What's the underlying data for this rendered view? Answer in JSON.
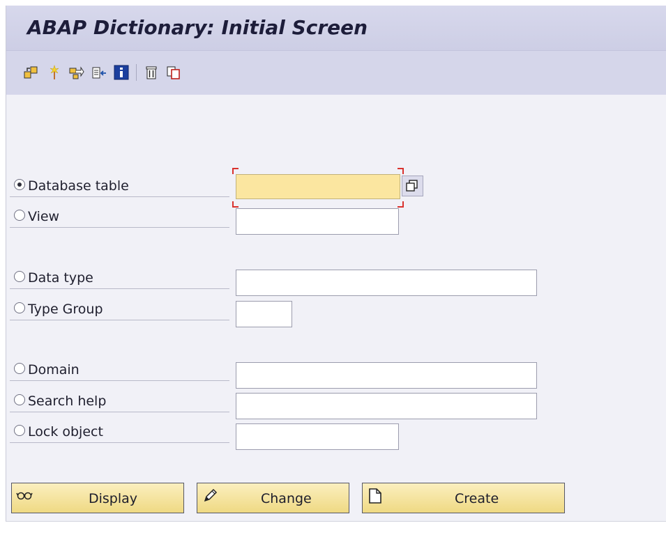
{
  "title": "ABAP Dictionary: Initial Screen",
  "toolbar": {
    "icons": [
      "other-object-icon",
      "generate-icon",
      "where-used-icon",
      "extend-icon",
      "info-icon",
      "delete-icon",
      "copy-icon"
    ]
  },
  "options": [
    {
      "label": "Database table",
      "selected": true,
      "value": ""
    },
    {
      "label": "View",
      "selected": false,
      "value": ""
    },
    {
      "label": "Data type",
      "selected": false,
      "value": ""
    },
    {
      "label": "Type Group",
      "selected": false,
      "value": ""
    },
    {
      "label": "Domain",
      "selected": false,
      "value": ""
    },
    {
      "label": "Search help",
      "selected": false,
      "value": ""
    },
    {
      "label": "Lock object",
      "selected": false,
      "value": ""
    }
  ],
  "buttons": {
    "display": "Display",
    "change": "Change",
    "create": "Create"
  },
  "colors": {
    "title_bar": "#d1d2e8",
    "focused_field": "#fbe6a0",
    "button": "#f3dd8f",
    "focus_corner": "#d9322e"
  }
}
